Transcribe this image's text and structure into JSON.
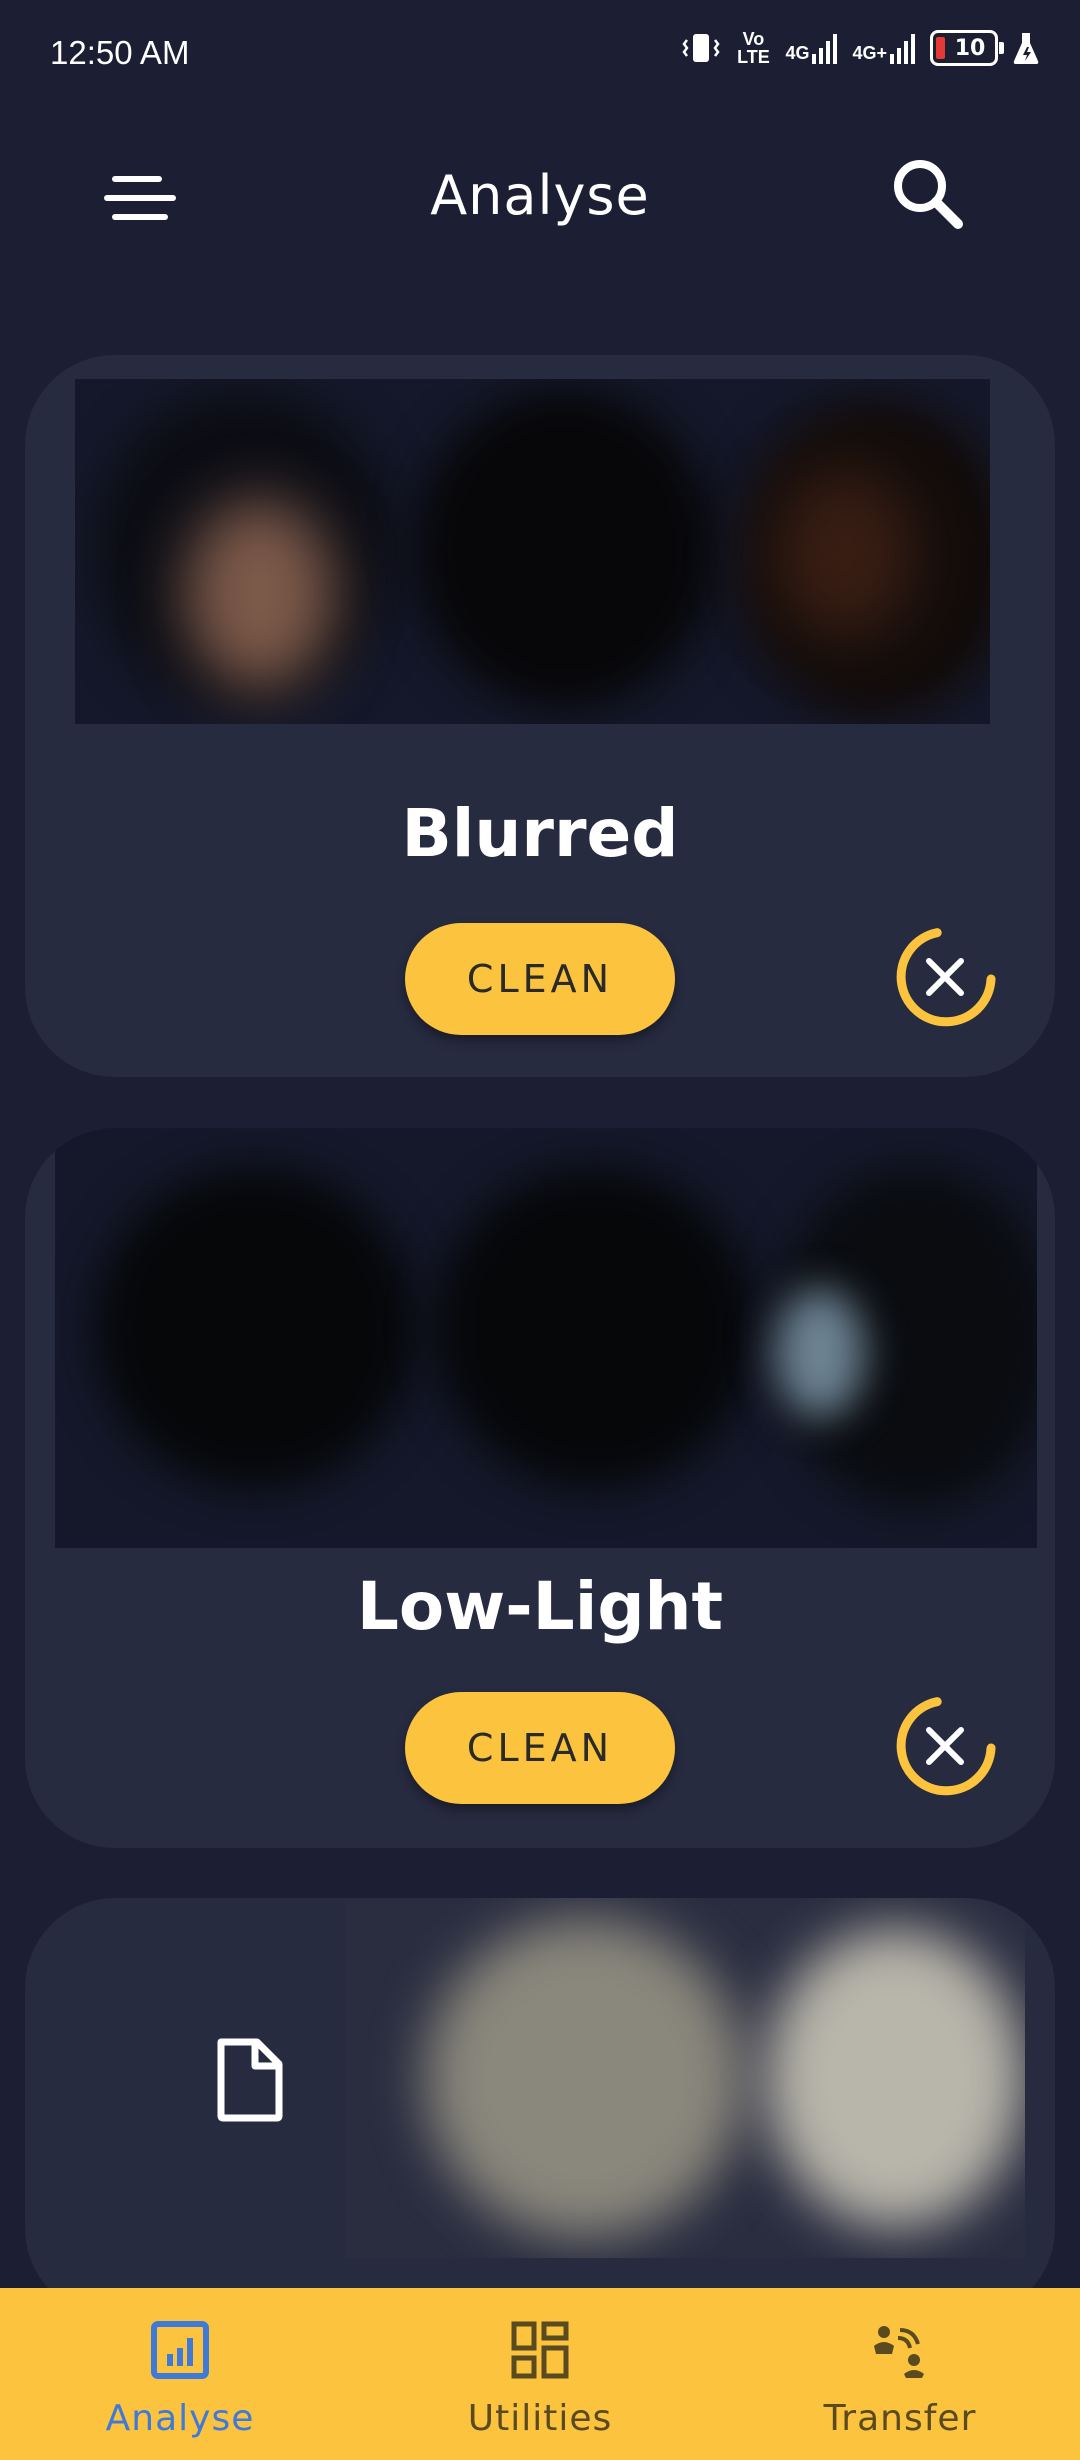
{
  "status_bar": {
    "time": "12:50 AM",
    "network_1": "Vo LTE",
    "network_2": "4G",
    "network_3": "4G+",
    "battery": "10"
  },
  "header": {
    "title": "Analyse",
    "menu_icon": "hamburger-menu-icon",
    "search_icon": "search-icon"
  },
  "cards": [
    {
      "title": "Blurred",
      "button": "CLEAN"
    },
    {
      "title": "Low-Light",
      "button": "CLEAN"
    },
    {
      "title": "",
      "button": ""
    }
  ],
  "bottom_nav": {
    "items": [
      {
        "label": "Analyse",
        "icon": "analyse-chart-icon",
        "active": true
      },
      {
        "label": "Utilities",
        "icon": "utilities-grid-icon",
        "active": false
      },
      {
        "label": "Transfer",
        "icon": "transfer-icon",
        "active": false
      }
    ]
  },
  "colors": {
    "background": "#1c1f33",
    "card": "#272b40",
    "accent": "#fbc33e",
    "active_nav": "#3f7ad8"
  }
}
